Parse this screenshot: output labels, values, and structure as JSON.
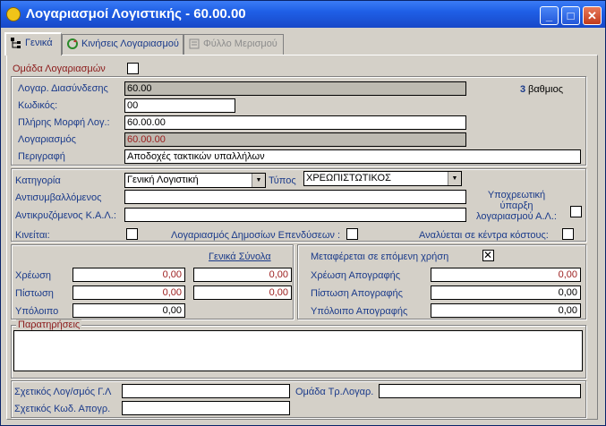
{
  "window": {
    "title": "Λογαριασμοί Λογιστικής - 60.00.00",
    "minimize": "_",
    "maximize": "□",
    "close": "✕"
  },
  "tabs": [
    {
      "label": "Γενικά"
    },
    {
      "label": "Κινήσεις Λογαριασμού"
    },
    {
      "label": "Φύλλο Μερισμού"
    }
  ],
  "general": {
    "account_group_label": "Ομάδα Λογαριασμών",
    "account_group_checked": false,
    "link_account_label": "Λογαρ. Διασύνδεσης",
    "link_account_value": "60.00",
    "degree_number": "3",
    "degree_label": "βαθμιος",
    "code_label": "Κωδικός:",
    "code_value": "00",
    "full_form_label": "Πλήρης Μορφή Λογ.:",
    "full_form_value": "60.00.00",
    "account_label": "Λογαριασμός",
    "account_value": "60.00.00",
    "description_label": "Περιγραφή",
    "description_value": "Αποδοχές τακτικών υπαλλήλων"
  },
  "category": {
    "category_label": "Κατηγορία",
    "category_value": "Γενική Λογιστική",
    "type_label": "Τύπος",
    "type_value": "ΧΡΕΩΠΙΣΤΩΤΙΚΟΣ",
    "offset_label": "Αντισυμβαλλόμενος",
    "offset_value": "",
    "mirror_label": "Αντικρυζόμενος Κ.Α.Λ.:",
    "mirror_value": "",
    "mandatory_label": "Υποχρεωτική ύπαρξη λογαριασμού Α.Λ.:",
    "mandatory_checked": false,
    "moves_label": "Κινείται:",
    "moves_checked": false,
    "public_inv_label": "Λογαριασμός Δημοσίων Επενδύσεων :",
    "public_inv_checked": false,
    "cost_center_label": "Αναλύεται σε κέντρα κόστους:",
    "cost_center_checked": false
  },
  "totals": {
    "general_totals_label": "Γενικά Σύνολα",
    "debit_label": "Χρέωση",
    "debit_value": "0,00",
    "debit_total": "0,00",
    "credit_label": "Πίστωση",
    "credit_value": "0,00",
    "credit_total": "0,00",
    "balance_label": "Υπόλοιπο",
    "balance_value": "0,00"
  },
  "inventory": {
    "carry_label": "Μεταφέρεται σε επόμενη χρήση",
    "carry_checked": true,
    "inv_debit_label": "Χρέωση Απογραφής",
    "inv_debit_value": "0,00",
    "inv_credit_label": "Πίστωση Απογραφής",
    "inv_credit_value": "0,00",
    "inv_balance_label": "Υπόλοιπο Απογραφής",
    "inv_balance_value": "0,00"
  },
  "notes": {
    "label": "Παρατηρήσεις",
    "value": ""
  },
  "related": {
    "gl_label": "Σχετικός Λογ/σμός Γ.Λ",
    "gl_value": "",
    "group_label": "Ομάδα Τρ.Λογαρ.",
    "group_value": "",
    "inv_code_label": "Σχετικός Κωδ. Απογρ.",
    "inv_code_value": ""
  }
}
